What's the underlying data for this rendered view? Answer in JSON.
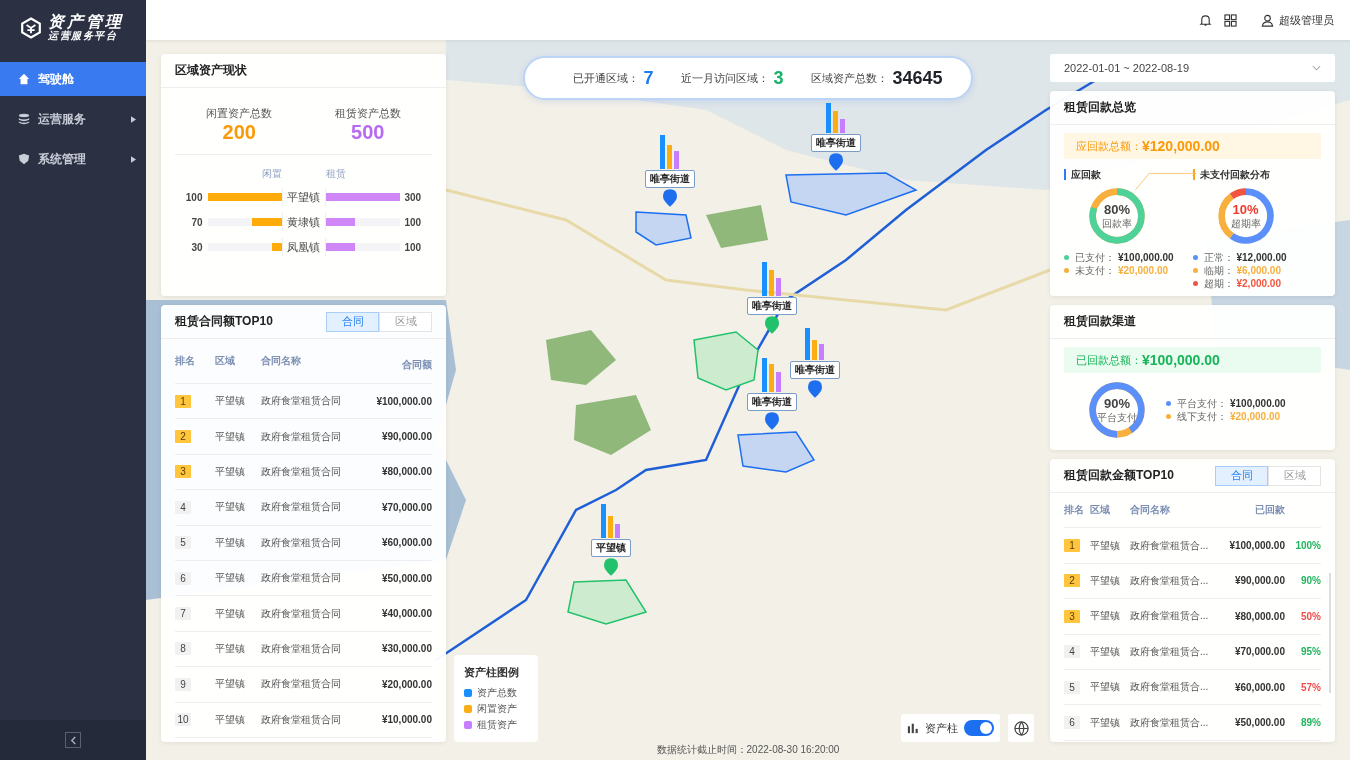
{
  "sidebar": {
    "logo_title": "资产管理",
    "logo_subtitle": "运营服务平台",
    "items": [
      {
        "label": "驾驶舱",
        "selected": true,
        "has_submenu": false
      },
      {
        "label": "运营服务",
        "selected": false,
        "has_submenu": true
      },
      {
        "label": "系统管理",
        "selected": false,
        "has_submenu": true
      }
    ]
  },
  "header": {
    "user": "超级管理员"
  },
  "stats": [
    {
      "label": "已开通区域：",
      "value": "7",
      "color": "#1e7cf2"
    },
    {
      "label": "近一月访问区域：",
      "value": "3",
      "color": "#18b36b"
    },
    {
      "label": "区域资产总数：",
      "value": "34645",
      "color": "#1f2329"
    }
  ],
  "region_assets": {
    "title": "区域资产现状",
    "idle": {
      "label": "闲置资产总数",
      "value": "200"
    },
    "rented": {
      "label": "租赁资产总数",
      "value": "500"
    },
    "idle_axis": "闲置",
    "rented_axis": "租赁",
    "rows": [
      {
        "town": "平望镇",
        "idle": {
          "value": "100",
          "level": 1
        },
        "rented": {
          "value": "300",
          "level": 1
        }
      },
      {
        "town": "黄埭镇",
        "idle": {
          "value": "70",
          "level": 0.4
        },
        "rented": {
          "value": "100",
          "level": 0.4
        }
      },
      {
        "town": "凤凰镇",
        "idle": {
          "value": "30",
          "level": 0.13
        },
        "rented": {
          "value": "100",
          "level": 0.4
        }
      }
    ]
  },
  "contracts_top10": {
    "title": "租赁合同额TOP10",
    "tabs": [
      {
        "label": "合同",
        "selected": true
      },
      {
        "label": "区域",
        "selected": false
      }
    ],
    "columns": [
      "排名",
      "区域",
      "合同名称",
      "合同额"
    ],
    "rows": [
      {
        "rank": "1",
        "top": true,
        "region": "平望镇",
        "name": "政府食堂租赁合同",
        "amount": "¥100,000.00"
      },
      {
        "rank": "2",
        "top": true,
        "region": "平望镇",
        "name": "政府食堂租赁合同",
        "amount": "¥90,000.00"
      },
      {
        "rank": "3",
        "top": true,
        "region": "平望镇",
        "name": "政府食堂租赁合同",
        "amount": "¥80,000.00"
      },
      {
        "rank": "4",
        "top": false,
        "region": "平望镇",
        "name": "政府食堂租赁合同",
        "amount": "¥70,000.00"
      },
      {
        "rank": "5",
        "top": false,
        "region": "平望镇",
        "name": "政府食堂租赁合同",
        "amount": "¥60,000.00"
      },
      {
        "rank": "6",
        "top": false,
        "region": "平望镇",
        "name": "政府食堂租赁合同",
        "amount": "¥50,000.00"
      },
      {
        "rank": "7",
        "top": false,
        "region": "平望镇",
        "name": "政府食堂租赁合同",
        "amount": "¥40,000.00"
      },
      {
        "rank": "8",
        "top": false,
        "region": "平望镇",
        "name": "政府食堂租赁合同",
        "amount": "¥30,000.00"
      },
      {
        "rank": "9",
        "top": false,
        "region": "平望镇",
        "name": "政府食堂租赁合同",
        "amount": "¥20,000.00"
      },
      {
        "rank": "10",
        "top": false,
        "region": "平望镇",
        "name": "政府食堂租赁合同",
        "amount": "¥10,000.00"
      }
    ]
  },
  "map": {
    "markers": [
      {
        "label": "唯亭街道",
        "color": "#1e6ff0"
      },
      {
        "label": "唯亭街道",
        "color": "#1e6ff0"
      },
      {
        "label": "唯亭街道",
        "color": "#22c16b"
      },
      {
        "label": "唯亭街道",
        "color": "#1e6ff0"
      },
      {
        "label": "唯亭街道",
        "color": "#1e6ff0"
      },
      {
        "label": "平望镇",
        "color": "#22c16b"
      }
    ],
    "legend": {
      "title": "资产柱图例",
      "items": [
        {
          "label": "资产总数",
          "color": "#1890ff"
        },
        {
          "label": "闲置资产",
          "color": "#faad14"
        },
        {
          "label": "租赁资产",
          "color": "#c77dff"
        }
      ]
    },
    "toggle": {
      "label": "资产柱",
      "on": true
    }
  },
  "date_range": {
    "value": "2022-01-01 ~ 2022-08-19"
  },
  "repayment_overview": {
    "title": "租赁回款总览",
    "total_label": "应回款总额：",
    "total": "¥120,000.00",
    "due": {
      "heading": "应回款",
      "percent": "80%",
      "caption": "回款率",
      "level": 0.8,
      "items": [
        {
          "label": "已支付：",
          "value": "¥100,000.00",
          "color": "#4fd19a"
        },
        {
          "label": "未支付：",
          "value": "¥20,000.00",
          "color": "#f7b03d"
        }
      ]
    },
    "unpaid": {
      "heading": "未支付回款分布",
      "percent": "10%",
      "caption": "超期率",
      "items": [
        {
          "label": "正常：",
          "value": "¥12,000.00",
          "color": "#5b8ff9"
        },
        {
          "label": "临期：",
          "value": "¥6,000.00",
          "color": "#f7b03d"
        },
        {
          "label": "超期：",
          "value": "¥2,000.00",
          "color": "#f2553f"
        }
      ]
    }
  },
  "channels": {
    "title": "租赁回款渠道",
    "total_label": "已回款总额：",
    "total": "¥100,000.00",
    "percent": "90%",
    "caption": "平台支付",
    "level": 0.9,
    "items": [
      {
        "label": "平台支付：",
        "value": "¥100,000.00",
        "color": "#5b8ff9"
      },
      {
        "label": "线下支付：",
        "value": "¥20,000.00",
        "color": "#f7b03d"
      }
    ]
  },
  "repay_top10": {
    "title": "租赁回款金额TOP10",
    "tabs": [
      {
        "label": "合同",
        "selected": true
      },
      {
        "label": "区域",
        "selected": false
      }
    ],
    "columns": [
      "排名",
      "区域",
      "合同名称",
      "已回款"
    ],
    "rows": [
      {
        "rank": "1",
        "top": true,
        "region": "平望镇",
        "name": "政府食堂租赁合...",
        "amount": "¥100,000.00",
        "rate": "100%",
        "color": "#22b35e"
      },
      {
        "rank": "2",
        "top": true,
        "region": "平望镇",
        "name": "政府食堂租赁合...",
        "amount": "¥90,000.00",
        "rate": "90%",
        "color": "#22b35e"
      },
      {
        "rank": "3",
        "top": true,
        "region": "平望镇",
        "name": "政府食堂租赁合...",
        "amount": "¥80,000.00",
        "rate": "50%",
        "color": "#f04d4d"
      },
      {
        "rank": "4",
        "top": false,
        "region": "平望镇",
        "name": "政府食堂租赁合...",
        "amount": "¥70,000.00",
        "rate": "95%",
        "color": "#22b35e"
      },
      {
        "rank": "5",
        "top": false,
        "region": "平望镇",
        "name": "政府食堂租赁合...",
        "amount": "¥60,000.00",
        "rate": "57%",
        "color": "#f04d4d"
      },
      {
        "rank": "6",
        "top": false,
        "region": "平望镇",
        "name": "政府食堂租赁合...",
        "amount": "¥50,000.00",
        "rate": "89%",
        "color": "#22b35e"
      }
    ]
  },
  "footer": "数据统计截止时间：2022-08-30 16:20:00"
}
